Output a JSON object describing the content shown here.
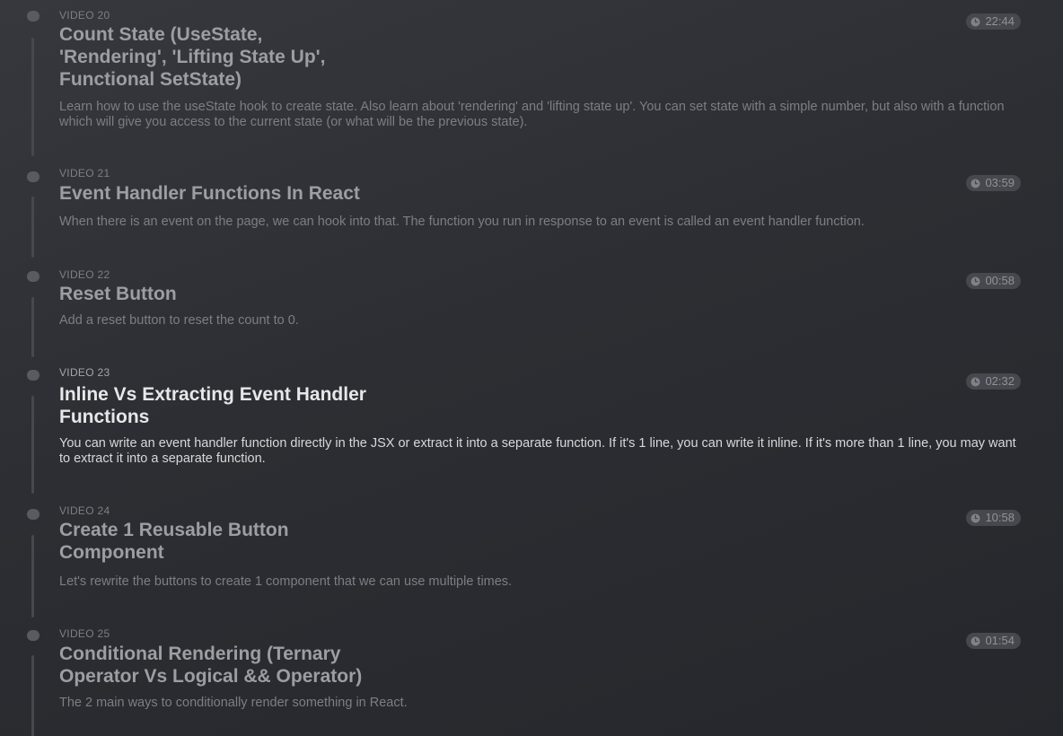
{
  "videos": [
    {
      "label": "VIDEO 20",
      "title": "Count State (UseState, 'Rendering', 'Lifting State Up', Functional SetState)",
      "description": "Learn how to use the useState hook to create state. Also learn about 'rendering' and 'lifting state up'. You can set state with a simple number, but also with a function which will give you access to the current state (or what will be the previous state).",
      "duration": "22:44",
      "duration_icon": "clock-icon"
    },
    {
      "label": "VIDEO 21",
      "title": "Event Handler Functions In React",
      "description": "When there is an event on the page, we can hook into that. The function you run in response to an event is called an event handler function.",
      "duration": "03:59",
      "duration_icon": "clock-icon"
    },
    {
      "label": "VIDEO 22",
      "title": "Reset Button",
      "description": "Add a reset button to reset the count to 0.",
      "duration": "00:58",
      "duration_icon": "clock-icon"
    },
    {
      "label": "VIDEO 23",
      "title": "Inline Vs Extracting Event Handler Functions",
      "description": "You can write an event handler function directly in the JSX or extract it into a separate function. If it's 1 line, you can write it inline. If it's more than 1 line, you may want to extract it into a separate function.",
      "duration": "02:32",
      "duration_icon": "clock-icon",
      "active": true
    },
    {
      "label": "VIDEO 24",
      "title": "Create 1 Reusable Button Component",
      "description": "Let's rewrite the buttons to create 1 component that we can use multiple times.",
      "duration": "10:58",
      "duration_icon": "clock-icon"
    },
    {
      "label": "VIDEO 25",
      "title": "Conditional Rendering (Ternary Operator Vs Logical && Operator)",
      "description": "The 2 main ways to conditionally render something in React.",
      "duration": "01:54",
      "duration_icon": "clock-icon"
    }
  ],
  "colors": {
    "background": "#2c2e33",
    "timeline": "#46484e",
    "active_title": "#e6e7e9",
    "inactive_title": "#9c9ea3"
  }
}
